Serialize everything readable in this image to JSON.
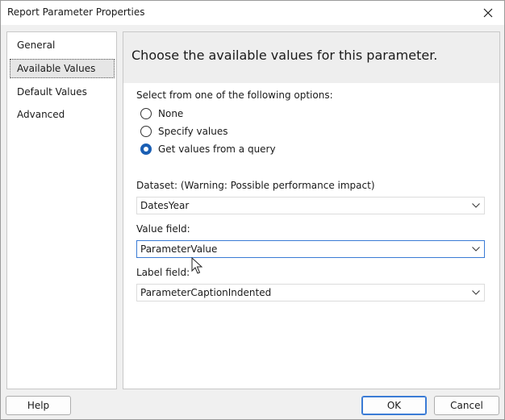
{
  "window": {
    "title": "Report Parameter Properties"
  },
  "nav": {
    "items": [
      {
        "label": "General",
        "selected": false
      },
      {
        "label": "Available Values",
        "selected": true
      },
      {
        "label": "Default Values",
        "selected": false
      },
      {
        "label": "Advanced",
        "selected": false
      }
    ]
  },
  "panel": {
    "heading": "Choose the available values for this parameter.",
    "options_label": "Select from one of the following options:",
    "options": [
      {
        "label": "None",
        "checked": false
      },
      {
        "label": "Specify values",
        "checked": false
      },
      {
        "label": "Get values from a query",
        "checked": true
      }
    ],
    "dataset": {
      "label": "Dataset: (Warning: Possible performance impact)",
      "value": "DatesYear"
    },
    "value_field": {
      "label": "Value field:",
      "value": "ParameterValue"
    },
    "label_field": {
      "label": "Label field:",
      "value": "ParameterCaptionIndented"
    }
  },
  "buttons": {
    "help": "Help",
    "ok": "OK",
    "cancel": "Cancel"
  },
  "colors": {
    "accent": "#1a5fb4",
    "focus_border": "#3a7bd5"
  },
  "icons": {
    "close": "close-icon",
    "dropdown": "chevron-down-icon",
    "cursor": "mouse-pointer-icon"
  }
}
